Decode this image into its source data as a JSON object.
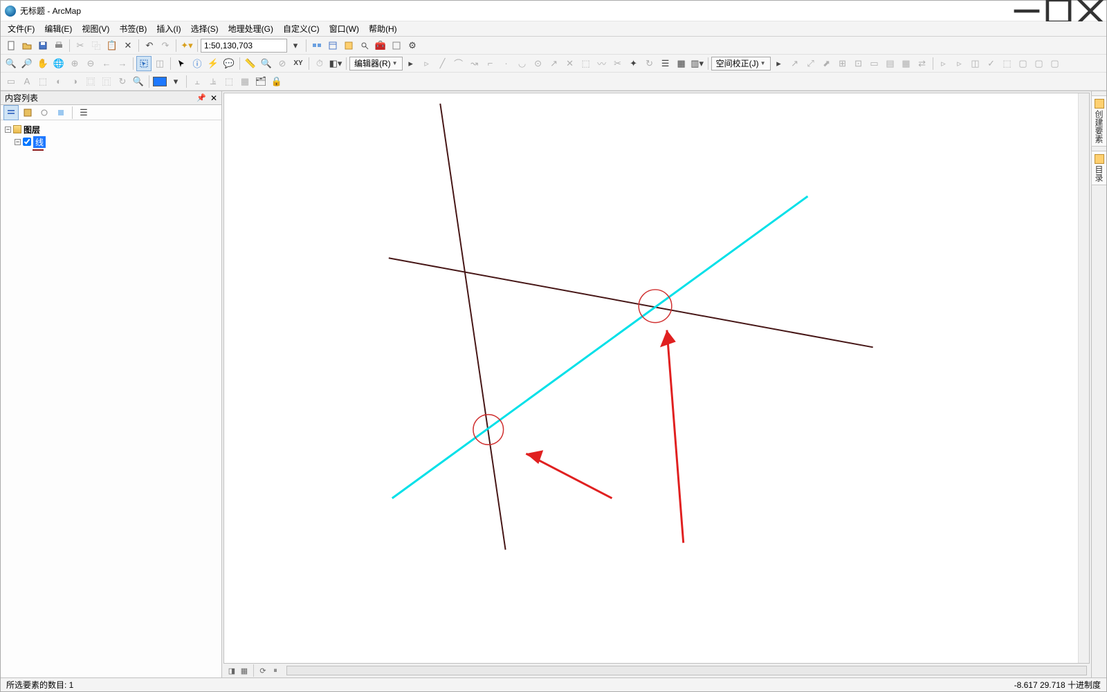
{
  "title": "无标题 - ArcMap",
  "menus": [
    "文件(F)",
    "编辑(E)",
    "视图(V)",
    "书签(B)",
    "插入(I)",
    "选择(S)",
    "地理处理(G)",
    "自定义(C)",
    "窗口(W)",
    "帮助(H)"
  ],
  "toolbar1": {
    "scale": "1:50,130,703"
  },
  "toolbar2": {
    "editor_label": "编辑器(R)",
    "spatial_adj_label": "空间校正(J)"
  },
  "toc": {
    "title": "内容列表",
    "root": "图层",
    "layer_name": "线"
  },
  "rightdock": {
    "tab1": "创建要素",
    "tab2": "目录"
  },
  "status": {
    "left": "所选要素的数目: 1",
    "coords": "-8.617 29.718 十进制度"
  }
}
